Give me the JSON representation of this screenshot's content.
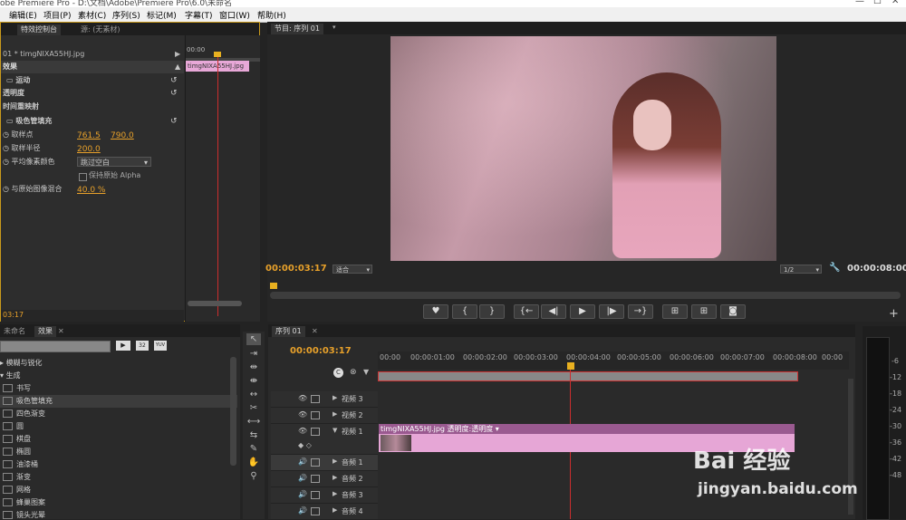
{
  "app": {
    "title": "obe Premiere Pro - D:\\文档\\Adobe\\Premiere Pro\\6.0\\未命名",
    "winctl": [
      "—",
      "☐",
      "✕"
    ]
  },
  "menu": [
    "编辑(E)",
    "项目(P)",
    "素材(C)",
    "序列(S)",
    "标记(M)",
    "字幕(T)",
    "窗口(W)",
    "帮助(H)"
  ],
  "effect_controls": {
    "tabs": [
      "特效控制台",
      "源: (无素材)"
    ],
    "clip_header": "01 * timgNIXA55HJ.jpg",
    "timecode_start": "00:00",
    "clip_chip": "timgNIXA55HJ.jpg",
    "section": "效果",
    "motion": "运动",
    "opacity": "透明度",
    "time_remap": "时间重映射",
    "effect_name": "吸色管填充",
    "sample_point_label": "取样点",
    "sample_x": "761.5",
    "sample_y": "790.0",
    "sample_radius_label": "取样半径",
    "sample_radius": "200.0",
    "avg_color_label": "平均像素颜色",
    "avg_color_value": "跳过空白",
    "keep_alpha_label": "保持原始 Alpha",
    "blend_label": "与原始图像混合",
    "blend_value": "40.0 %",
    "bottom_timecode": "03:17"
  },
  "program_monitor": {
    "tab": "节目: 序列 01",
    "timecode": "00:00:03:17",
    "fit": "适合",
    "res": "1/2",
    "duration": "00:00:08:00",
    "transport": [
      "♥",
      "{",
      "}",
      "{←",
      "◀|",
      "▶",
      "|▶",
      "→}",
      "⊞",
      "⊞",
      "◙"
    ],
    "add": "+"
  },
  "effects_panel": {
    "tabs": [
      "未命名",
      "效果"
    ],
    "icons": [
      "32",
      "YUV"
    ],
    "items": [
      "模糊与锐化",
      "生成",
      "书写",
      "吸色管填充",
      "四色渐变",
      "圆",
      "棋盘",
      "椭圆",
      "油漆桶",
      "渐变",
      "网格",
      "蜂巢图案",
      "镜头光晕"
    ]
  },
  "timeline": {
    "tab": "序列 01",
    "timecode": "00:00:03:17",
    "ruler": [
      "00:00",
      "00:00:01:00",
      "00:00:02:00",
      "00:00:03:00",
      "00:00:04:00",
      "00:00:05:00",
      "00:00:06:00",
      "00:00:07:00",
      "00:00:08:00",
      "00:00"
    ],
    "tracks": [
      "视频 3",
      "视频 2",
      "视频 1",
      "音频 1",
      "音频 2",
      "音频 3",
      "音频 4"
    ],
    "clip_label": "timgNIXA55HJ.jpg  透明度:透明度 ▾"
  },
  "meter": {
    "ticks": [
      "-6",
      "-12",
      "-18",
      "-24",
      "-30",
      "-36",
      "-42",
      "-48"
    ]
  },
  "watermark": {
    "brand": "Bai 经验",
    "url": "jingyan.baidu.com"
  }
}
